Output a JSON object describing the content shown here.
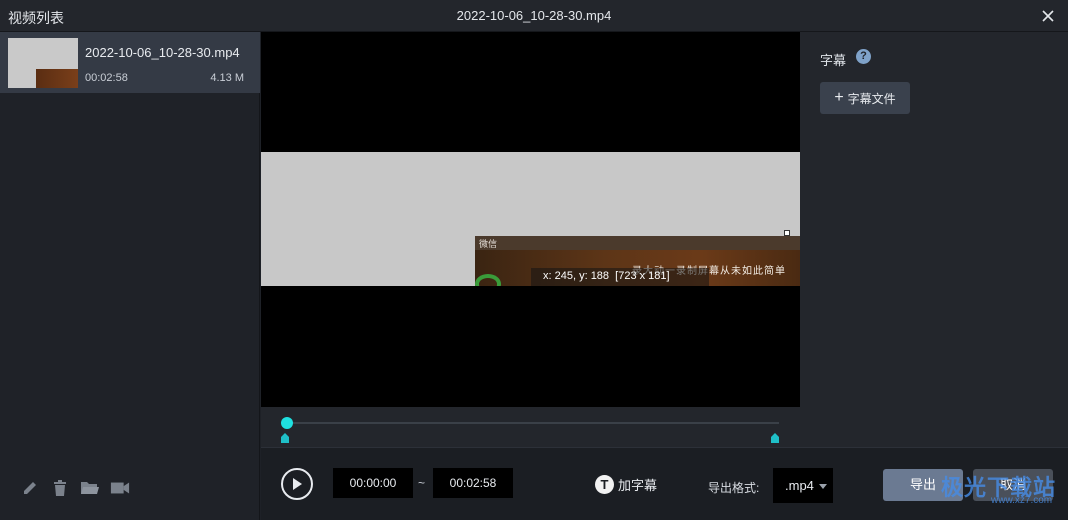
{
  "titlebar": {
    "left_title": "视频列表",
    "center_title": "2022-10-06_10-28-30.mp4"
  },
  "video_list": {
    "items": [
      {
        "name": "2022-10-06_10-28-30.mp4",
        "duration": "00:02:58",
        "size": "4.13 M"
      }
    ]
  },
  "left_tools": [
    "pencil-icon",
    "trash-icon",
    "open-folder-icon",
    "video-camera-icon"
  ],
  "preview": {
    "capture_header": "微信",
    "capture_text": "录大动一录制屏幕从未如此简单",
    "coord_text": "x: 245, y: 188  [723 x 181]"
  },
  "right_panel": {
    "title": "字幕",
    "help": "?",
    "add_button": "字幕文件"
  },
  "bottom": {
    "start_time": "00:00:00",
    "separator": "~",
    "end_time": "00:02:58",
    "add_caption": "加字幕",
    "format_label": "导出格式:",
    "format_value": ".mp4",
    "export_button": "导出",
    "cancel_button": "取消"
  },
  "watermark": {
    "title": "极光下载站",
    "url": "www.xz7.com"
  },
  "colors": {
    "accent": "#1fe0e0",
    "panel": "#23262c",
    "selected_item": "#343a45"
  }
}
